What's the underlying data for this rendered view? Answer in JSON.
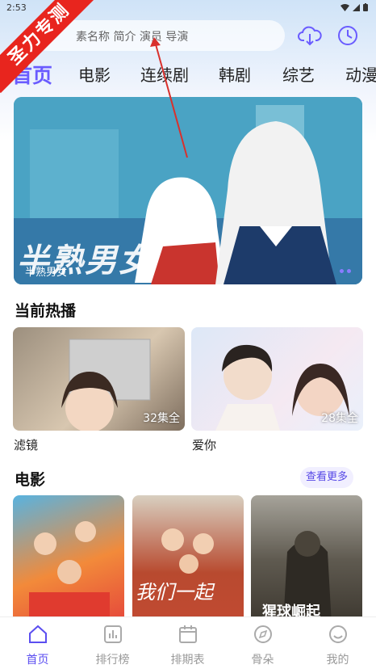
{
  "status_bar": {
    "time": "2:53"
  },
  "watermark": {
    "text": "圣力专测"
  },
  "search": {
    "placeholder": "搜索名称 简介 演员 导演",
    "visible_text": "素名称 简介 演员 导演"
  },
  "top_icons": [
    "cloud-download-icon",
    "history-clock-icon"
  ],
  "tabs": [
    {
      "label": "首页",
      "active": true
    },
    {
      "label": "电影",
      "active": false
    },
    {
      "label": "连续剧",
      "active": false
    },
    {
      "label": "韩剧",
      "active": false
    },
    {
      "label": "综艺",
      "active": false
    },
    {
      "label": "动漫",
      "active": false
    }
  ],
  "banner": {
    "art_title": "半熟男女",
    "caption": "半熟男女"
  },
  "now_playing": {
    "title": "当前热播",
    "items": [
      {
        "title": "滤镜",
        "badge": "32集全"
      },
      {
        "title": "爱你",
        "badge": "28集全"
      }
    ]
  },
  "movies": {
    "title": "电影",
    "more_label": "查看更多",
    "items": [
      {
        "poster_text": ""
      },
      {
        "poster_text": "我们一起"
      },
      {
        "poster_text": "猩球崛起"
      }
    ]
  },
  "bottom_nav": [
    {
      "label": "首页",
      "icon": "home-icon",
      "active": true
    },
    {
      "label": "排行榜",
      "icon": "chart-icon",
      "active": false
    },
    {
      "label": "排期表",
      "icon": "calendar-icon",
      "active": false
    },
    {
      "label": "骨朵",
      "icon": "compass-icon",
      "active": false
    },
    {
      "label": "我的",
      "icon": "smiley-icon",
      "active": false
    }
  ],
  "colors": {
    "accent": "#6a5cff",
    "nav_active": "#5b4ef0",
    "ribbon": "#e8251e"
  }
}
